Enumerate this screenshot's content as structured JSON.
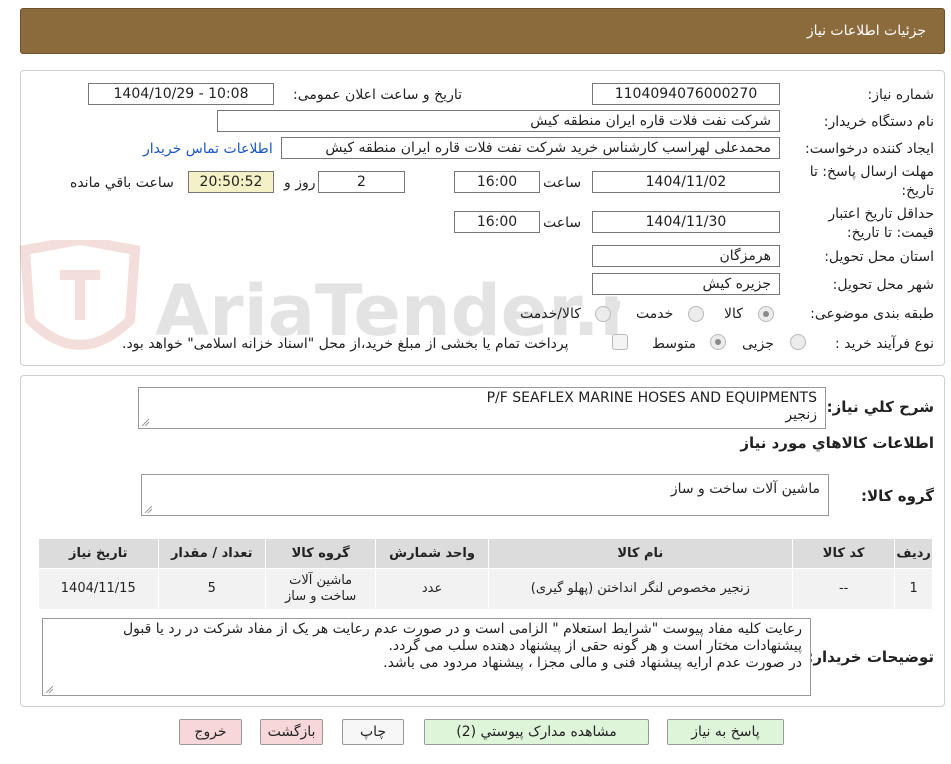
{
  "header": {
    "title": "جزئیات اطلاعات نیاز"
  },
  "need_number": {
    "label": "شماره نیاز:",
    "value": "1104094076000270"
  },
  "announce": {
    "label": "تاریخ و ساعت اعلان عمومی:",
    "value": "1404/10/29 - 10:08"
  },
  "buyer_org": {
    "label": "نام دستگاه خریدار:",
    "value": "شرکت نفت فلات قاره ایران منطقه کیش"
  },
  "requester": {
    "label": "ایجاد کننده درخواست:",
    "value": "محمدعلی لهراسب کارشناس خرید شرکت نفت فلات قاره ایران منطقه کیش",
    "contact_link": "اطلاعات تماس خریدار"
  },
  "reply_deadline": {
    "label": "مهلت ارسال پاسخ: تا تاریخ:",
    "date": "1404/11/02",
    "time_label": "ساعت",
    "time": "16:00",
    "days": "2",
    "days_label": "روز و",
    "remaining": "20:50:52",
    "remaining_label": "ساعت باقي مانده"
  },
  "validity": {
    "label": "حداقل تاریخ اعتبار قیمت: تا تاریخ:",
    "date": "1404/11/30",
    "time_label": "ساعت",
    "time": "16:00"
  },
  "province": {
    "label": "استان محل تحویل:",
    "value": "هرمزگان"
  },
  "city": {
    "label": "شهر محل تحویل:",
    "value": "جزیره کیش"
  },
  "category": {
    "label": "طبقه بندی موضوعی:",
    "options": [
      "کالا",
      "خدمت",
      "کالا/خدمت"
    ],
    "selected": "کالا"
  },
  "process": {
    "label": "نوع فرآیند خرید :",
    "options": [
      "جزیی",
      "متوسط"
    ],
    "selected": "متوسط",
    "note": "پرداخت تمام یا بخشی از مبلغ خرید،از محل \"اسناد خزانه اسلامی\" خواهد بود."
  },
  "watermark": {
    "text": "AriaTender.neT"
  },
  "summary": {
    "label": "شرح كلي نياز:",
    "line1": "P/F SEAFLEX MARINE HOSES AND EQUIPMENTS",
    "line2": "زنجیر"
  },
  "goods_info_title": "اطلاعات كالاهاي مورد نياز",
  "goods_group": {
    "label": "گروه كالا:",
    "value": "ماشین آلات ساخت و ساز"
  },
  "table": {
    "headers": [
      "ردیف",
      "کد کالا",
      "نام کالا",
      "واحد شمارش",
      "گروه کالا",
      "تعداد / مقدار",
      "تاریخ نیاز"
    ],
    "rows": [
      {
        "row": "1",
        "code": "--",
        "name": "زنجیر مخصوص لنگر انداختن (پهلو گیری)",
        "unit": "عدد",
        "group_line1": "ماشین آلات",
        "group_line2": "ساخت و ساز",
        "qty": "5",
        "date": "1404/11/15"
      }
    ]
  },
  "buyer_notes": {
    "label": "توضیحات خریدار:",
    "line1": "رعایت کلیه مفاد  پیوست \"شرایط استعلام \" الزامی است و در صورت عدم رعایت هر یک از مفاد شرکت در رد یا قبول",
    "line2": "پیشنهادات مختار است  و هر گونه حقی از پیشنهاد دهنده سلب می گردد.",
    "line3": "در صورت عدم ارایه پیشنهاد فنی و مالی مجزا ، پیشنهاد مردود می باشد."
  },
  "buttons": {
    "reply": "پاسخ به نیاز",
    "attachments": "مشاهده مدارک پیوستي (2)",
    "print": "چاپ",
    "back": "بازگشت",
    "exit": "خروج"
  }
}
